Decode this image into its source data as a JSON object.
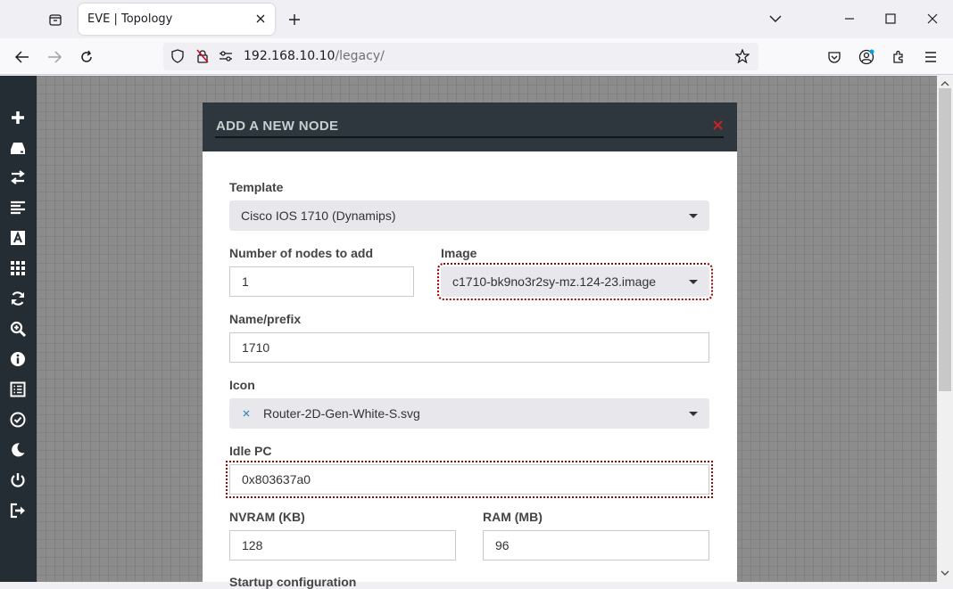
{
  "browser": {
    "tab_title": "EVE | Topology",
    "url_host": "192.168.10.10",
    "url_path": "/legacy/"
  },
  "sidebar": {
    "items": [
      "add-icon",
      "nodes-icon",
      "networks-icon",
      "startup-configs-icon",
      "text-icon",
      "grid-icon",
      "refresh-icon",
      "zoom-icon",
      "info-icon",
      "lab-details-icon",
      "status-icon",
      "dark-mode-icon",
      "power-icon",
      "logout-icon"
    ]
  },
  "modal": {
    "title": "ADD A NEW NODE",
    "template_label": "Template",
    "template_value": "Cisco IOS 1710 (Dynamips)",
    "count_label": "Number of nodes to add",
    "count_value": "1",
    "image_label": "Image",
    "image_value": "c1710-bk9no3r2sy-mz.124-23.image",
    "name_label": "Name/prefix",
    "name_value": "1710",
    "icon_label": "Icon",
    "icon_value": "Router-2D-Gen-White-S.svg",
    "idlepc_label": "Idle PC",
    "idlepc_value": "0x803637a0",
    "nvram_label": "NVRAM (KB)",
    "nvram_value": "128",
    "ram_label": "RAM (MB)",
    "ram_value": "96",
    "startup_label": "Startup configuration"
  },
  "colors": {
    "modal_header": "#2d373d",
    "sidebar": "#242d33",
    "close_x": "#cc2222",
    "highlight": "#a00000"
  }
}
